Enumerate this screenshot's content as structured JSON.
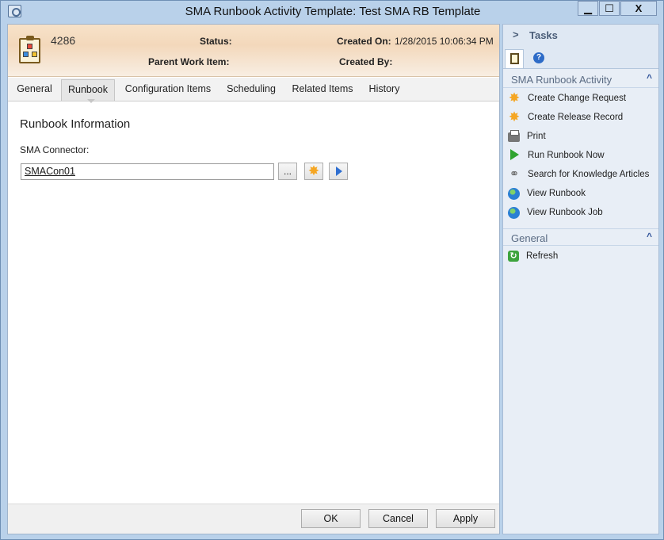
{
  "window": {
    "title": "SMA Runbook Activity Template: Test SMA RB Template",
    "minimize_glyph": "▁",
    "maximize_glyph": "☐",
    "close_glyph": "X"
  },
  "header": {
    "id": "4286",
    "status_label": "Status:",
    "status_value": "",
    "parent_label": "Parent Work Item:",
    "parent_value": "",
    "created_on_label": "Created On:",
    "created_on_value": "1/28/2015 10:06:34 PM",
    "created_by_label": "Created By:",
    "created_by_value": ""
  },
  "tabs": [
    {
      "label": "General",
      "active": false
    },
    {
      "label": "Runbook",
      "active": true
    },
    {
      "label": "Configuration Items",
      "active": false
    },
    {
      "label": "Scheduling",
      "active": false
    },
    {
      "label": "Related Items",
      "active": false
    },
    {
      "label": "History",
      "active": false
    }
  ],
  "content": {
    "section_title": "Runbook Information",
    "connector_label": "SMA Connector:",
    "connector_value": "SMACon01",
    "browse_label": "..."
  },
  "buttons": {
    "ok": "OK",
    "cancel": "Cancel",
    "apply": "Apply"
  },
  "tasks": {
    "title": "Tasks",
    "groups": [
      {
        "title": "SMA Runbook Activity",
        "items": [
          {
            "label": "Create Change Request",
            "icon": "star-icon"
          },
          {
            "label": "Create Release Record",
            "icon": "star-icon"
          },
          {
            "label": "Print",
            "icon": "printer-icon"
          },
          {
            "label": "Run Runbook Now",
            "icon": "play-icon"
          },
          {
            "label": "Search for Knowledge Articles",
            "icon": "link-icon"
          },
          {
            "label": "View Runbook",
            "icon": "globe-icon"
          },
          {
            "label": "View Runbook Job",
            "icon": "globe-icon"
          }
        ]
      },
      {
        "title": "General",
        "items": [
          {
            "label": "Refresh",
            "icon": "refresh-icon"
          }
        ]
      }
    ]
  },
  "colors": {
    "window_frame": "#b9d1ea",
    "header_gradient": "#f3d8bb",
    "tasks_bg": "#e8eef6",
    "accent": "#33559b"
  }
}
